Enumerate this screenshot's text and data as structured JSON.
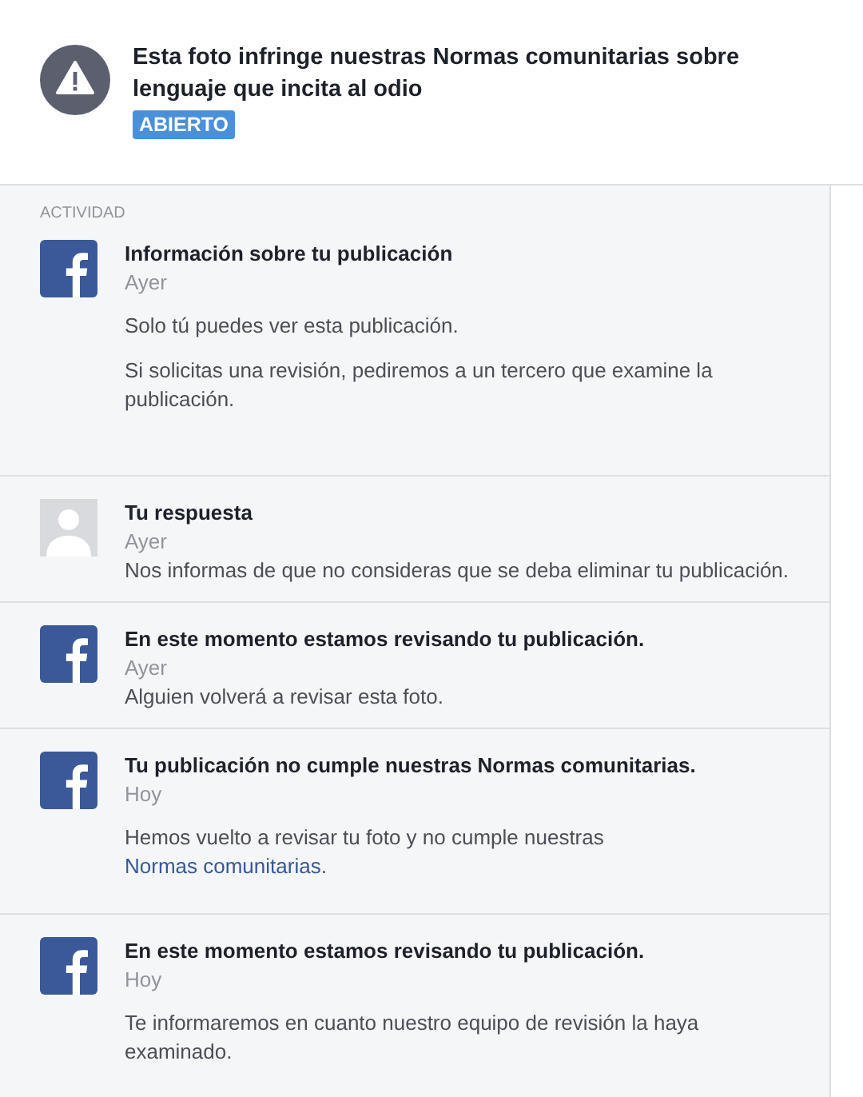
{
  "header": {
    "title": "Esta foto infringe nuestras Normas comunitarias sobre lenguaje que incita al odio",
    "status": "ABIERTO"
  },
  "activity": {
    "heading": "ACTIVIDAD",
    "entries": [
      {
        "kind": "system",
        "spaced": true,
        "title": "Información sobre tu publicación",
        "date": "Ayer",
        "paragraphs": [
          {
            "text": "Solo tú puedes ver esta publicación."
          },
          {
            "text": "Si solicitas una revisión, pediremos a un tercero que examine la publicación."
          }
        ]
      },
      {
        "kind": "user",
        "spaced": false,
        "title": "Tu respuesta",
        "date": "Ayer",
        "paragraphs": [
          {
            "text": "Nos informas de que no consideras que se deba eliminar tu publicación."
          }
        ]
      },
      {
        "kind": "system",
        "spaced": false,
        "title": "En este momento estamos revisando tu publicación.",
        "date": "Ayer",
        "paragraphs": [
          {
            "text": "Alguien volverá a revisar esta foto."
          }
        ]
      },
      {
        "kind": "system",
        "spaced": true,
        "title": "Tu publicación no cumple nuestras Normas comunitarias.",
        "date": "Hoy",
        "paragraphs": [
          {
            "text": "Hemos vuelto a revisar tu foto y no cumple nuestras ",
            "link": "Normas comunitarias",
            "after": "."
          }
        ]
      },
      {
        "kind": "system",
        "spaced": true,
        "title": "En este momento estamos revisando tu publicación.",
        "date": "Hoy",
        "paragraphs": [
          {
            "text": "Te informaremos en cuanto nuestro equipo de revisión la haya examinado."
          }
        ]
      }
    ]
  }
}
